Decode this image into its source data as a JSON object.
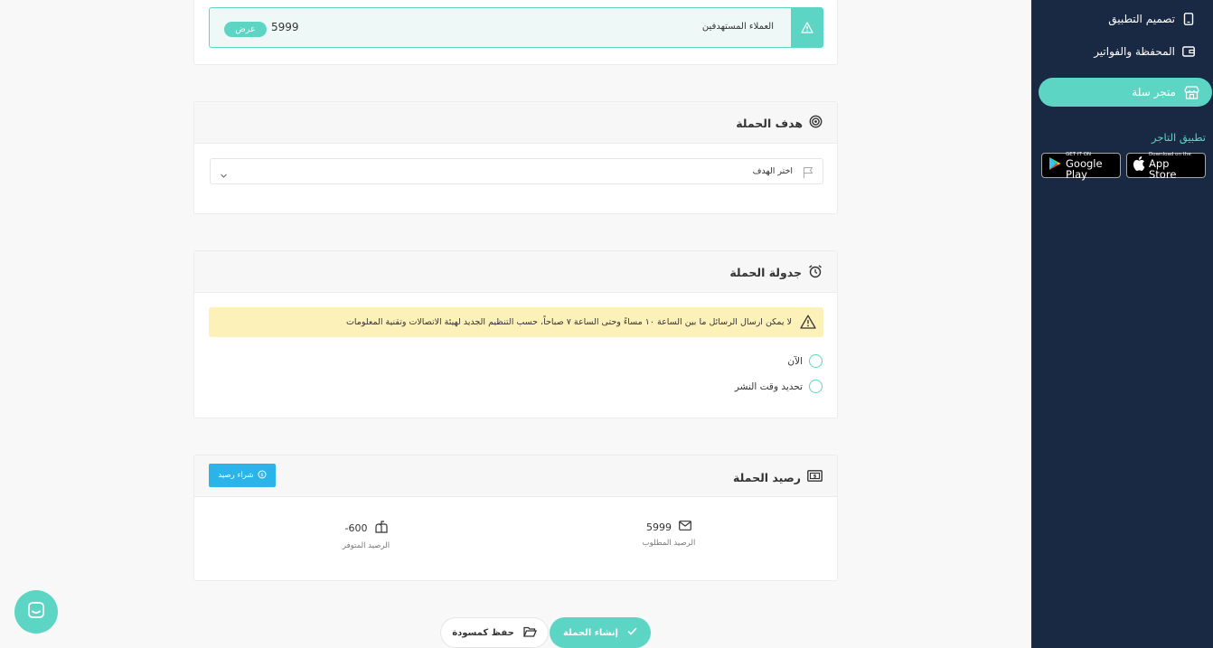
{
  "sidebar": {
    "items": [
      {
        "label": "تصميم التطبيق",
        "icon": "phone-icon"
      },
      {
        "label": "المحفظة والفواتير",
        "icon": "wallet-icon"
      },
      {
        "label": "متجر سلة",
        "icon": "store-icon"
      }
    ],
    "merchant_app_title": "تطبيق التاجر",
    "stores": {
      "google_small": "GET IT ON",
      "google_big": "Google Play",
      "apple_small": "Download on the",
      "apple_big": "App Store"
    }
  },
  "audience": {
    "label": "العملاء المستهدفين",
    "count": "5999",
    "view_label": "عرض"
  },
  "goal": {
    "title": "هدف الحملة",
    "placeholder": "اختر الهدف"
  },
  "schedule": {
    "title": "جدولة الحملة",
    "warning": "لا يمكن ارسال الرسائل ما بين الساعة ١٠ مساءً وحتى الساعة ٧ صباحاً، حسب التنظيم الجديد لهيئة الاتصالات وتقنية المعلومات",
    "options": [
      "الآن",
      "تحديد وقت النشر"
    ]
  },
  "balance": {
    "title": "رصيد الحملة",
    "buy_label": "شراء رصيد",
    "required_value": "5999",
    "required_label": "الرصيد المطلوب",
    "available_value": "600-",
    "available_label": "الرصيد المتوفر"
  },
  "actions": {
    "create_label": "إنشاء الحملة",
    "draft_label": "حفظ كمسودة"
  },
  "colors": {
    "accent": "#5dd5c4",
    "sidebar": "#1a2943",
    "buy_button": "#2ab4e8",
    "warning_bg": "#fdf1ba"
  }
}
